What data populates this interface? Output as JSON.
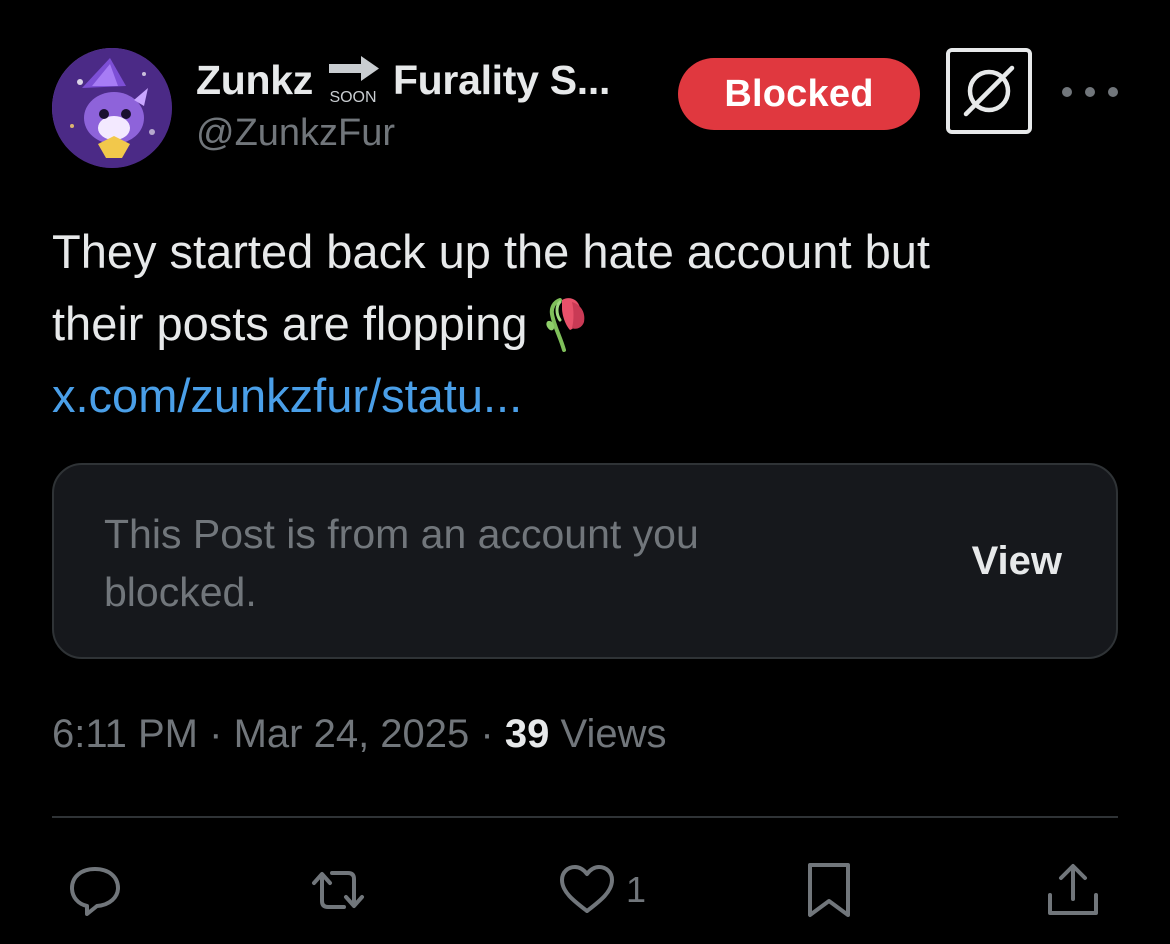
{
  "author": {
    "display_name": "Zunkz",
    "display_name_suffix": "Furality S...",
    "handle": "@ZunkzFur",
    "avatar": "avatar-image"
  },
  "header": {
    "soon_emoji_text": "SOON",
    "blocked_label": "Blocked",
    "grok_icon": "grok-icon",
    "more_icon": "more-icon"
  },
  "post": {
    "text_line1": "They started back up the hate account but",
    "text_line2": "their posts are flopping",
    "emoji": "wilted-flower-emoji",
    "link_text": "x.com/zunkzfur/statu..."
  },
  "quote_card": {
    "message": "This Post is from an account you blocked.",
    "view_label": "View"
  },
  "meta": {
    "time": "6:11 PM",
    "separator": "·",
    "date": "Mar 24, 2025",
    "views_count": "39",
    "views_label": "Views"
  },
  "actions": {
    "reply_icon": "reply-icon",
    "repost_icon": "repost-icon",
    "like_icon": "heart-icon",
    "like_count": "1",
    "bookmark_icon": "bookmark-icon",
    "share_icon": "share-icon"
  },
  "colors": {
    "background": "#000000",
    "text": "#e7e9ea",
    "muted": "#71767b",
    "link": "#4a9fe8",
    "blocked_red": "#e0383f",
    "card_bg": "#16181c",
    "border": "#2f3336"
  }
}
